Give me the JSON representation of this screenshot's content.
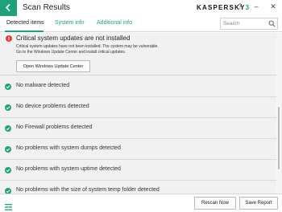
{
  "window": {
    "title": "Scan Results",
    "brand": {
      "main": "KASPERSKY",
      "accent": "3"
    },
    "help_label": "?",
    "minimize_label": "–",
    "close_label": "✕"
  },
  "tabs": [
    {
      "label": "Detected items",
      "active": true
    },
    {
      "label": "System info",
      "active": false
    },
    {
      "label": "Additional info",
      "active": false
    }
  ],
  "search": {
    "placeholder": "Search",
    "value": ""
  },
  "alert": {
    "title": "Critical system updates are not installed",
    "description_line1": "Critical system updates have not been installed. The system may be vulnerable.",
    "description_line2": "Go to the Windows Update Center and install critical updates.",
    "button_label": "Open Windows Update Center",
    "icon": "error-icon"
  },
  "items": [
    {
      "label": "No malware detected",
      "icon": "check-circle-icon"
    },
    {
      "label": "No device problems detected",
      "icon": "check-circle-icon"
    },
    {
      "label": "No Firewall problems detected",
      "icon": "check-circle-icon"
    },
    {
      "label": "No problems with system dumps detected",
      "icon": "check-circle-icon"
    },
    {
      "label": "No problems with system uptime detected",
      "icon": "check-circle-icon"
    },
    {
      "label": "No problems with the size of system temp folder detected",
      "icon": "check-circle-icon"
    }
  ],
  "footer": {
    "rescan_label": "Rescan Now",
    "save_label": "Save Report"
  },
  "colors": {
    "accent": "#1fa17a",
    "error": "#e53935",
    "background": "#f1f1f1"
  }
}
